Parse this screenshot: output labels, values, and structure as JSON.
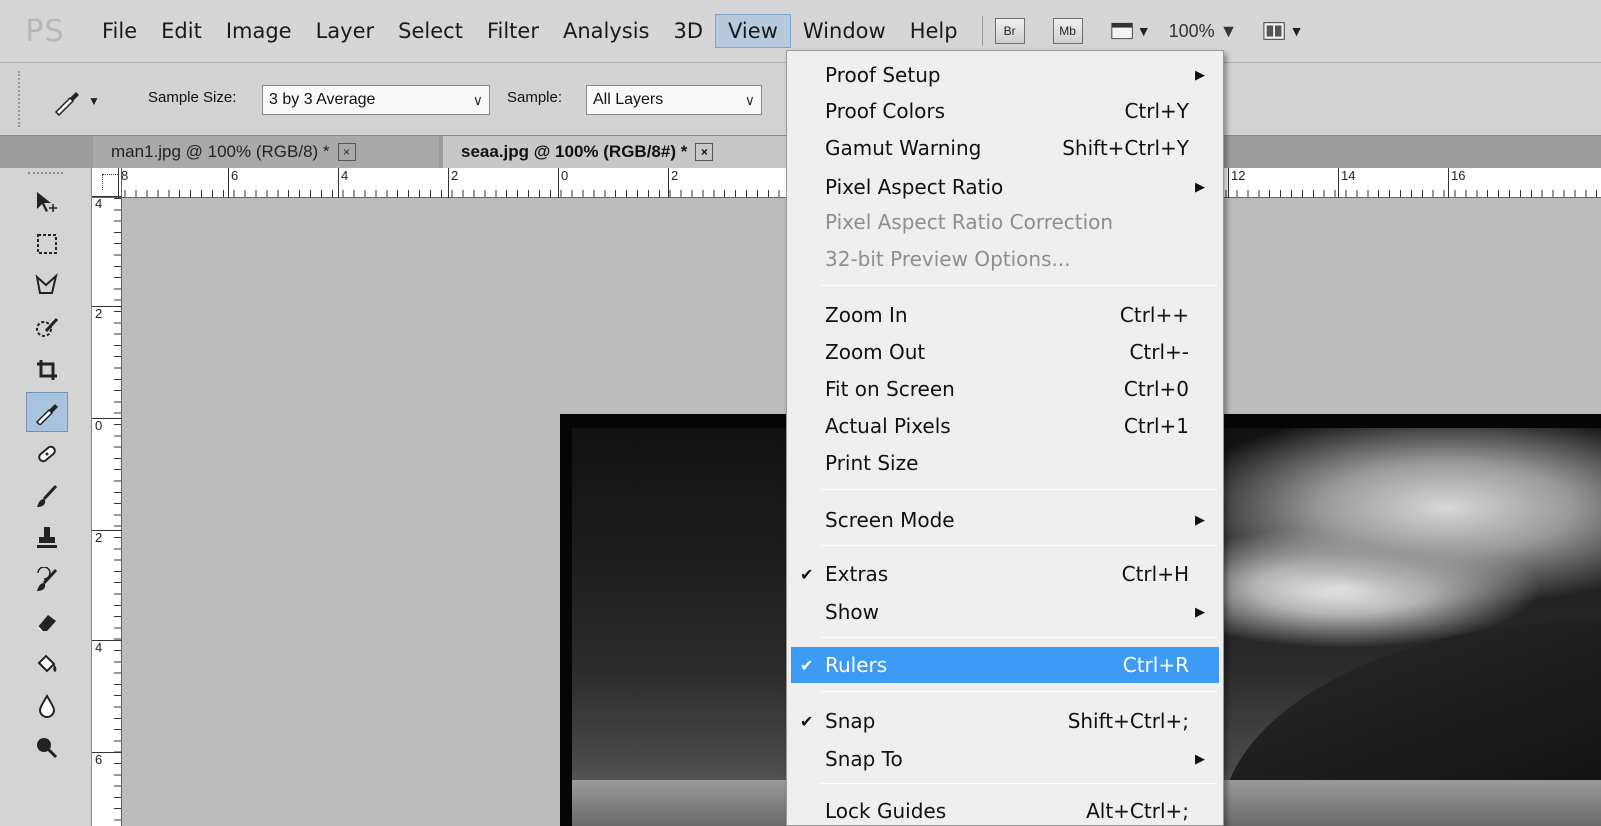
{
  "app": {
    "logo": "PS"
  },
  "menubar": {
    "items": [
      "File",
      "Edit",
      "Image",
      "Layer",
      "Select",
      "Filter",
      "Analysis",
      "3D",
      "View",
      "Window",
      "Help"
    ],
    "bridge_label": "Br",
    "minibridge_label": "Mb",
    "zoom_value": "100%",
    "icons": [
      "screen-mode-icon",
      "arrange-documents-icon"
    ]
  },
  "options": {
    "sample_size_label": "Sample Size:",
    "sample_size_value": "3 by 3 Average",
    "sample_label": "Sample:",
    "sample_value": "All Layers"
  },
  "tabs": [
    {
      "label": "man1.jpg @ 100% (RGB/8) *",
      "close": "×"
    },
    {
      "label": "seaa.jpg @ 100% (RGB/8#) *",
      "close": "×"
    }
  ],
  "ruler": {
    "h_labels": [
      "8",
      "6",
      "4",
      "2",
      "0",
      "2",
      "12",
      "14",
      "16"
    ],
    "v_labels": [
      "4",
      "2",
      "0",
      "2",
      "4",
      "6"
    ]
  },
  "view_menu": {
    "items": [
      {
        "label": "Proof Setup",
        "shortcut": "",
        "submenu": true
      },
      {
        "label": "Proof Colors",
        "shortcut": "Ctrl+Y"
      },
      {
        "label": "Gamut Warning",
        "shortcut": "Shift+Ctrl+Y"
      },
      {
        "label": "Pixel Aspect Ratio",
        "shortcut": "",
        "submenu": true
      },
      {
        "label": "Pixel Aspect Ratio Correction",
        "shortcut": "",
        "disabled": true
      },
      {
        "label": "32-bit Preview Options...",
        "shortcut": "",
        "disabled": true
      },
      {
        "label": "Zoom In",
        "shortcut": "Ctrl++"
      },
      {
        "label": "Zoom Out",
        "shortcut": "Ctrl+-"
      },
      {
        "label": "Fit on Screen",
        "shortcut": "Ctrl+0"
      },
      {
        "label": "Actual Pixels",
        "shortcut": "Ctrl+1"
      },
      {
        "label": "Print Size",
        "shortcut": ""
      },
      {
        "label": "Screen Mode",
        "shortcut": "",
        "submenu": true
      },
      {
        "label": "Extras",
        "shortcut": "Ctrl+H",
        "checked": true
      },
      {
        "label": "Show",
        "shortcut": "",
        "submenu": true
      },
      {
        "label": "Rulers",
        "shortcut": "Ctrl+R",
        "checked": true,
        "highlighted": true
      },
      {
        "label": "Snap",
        "shortcut": "Shift+Ctrl+;",
        "checked": true
      },
      {
        "label": "Snap To",
        "shortcut": "",
        "submenu": true
      },
      {
        "label": "Lock Guides",
        "shortcut": "Alt+Ctrl+;"
      }
    ],
    "check_glyph": "✔",
    "arrow_glyph": "▶"
  },
  "colors": {
    "highlight": "#3d9af5",
    "menu_active": "#b7c9de",
    "tool_selected": "#a8c4e0"
  }
}
